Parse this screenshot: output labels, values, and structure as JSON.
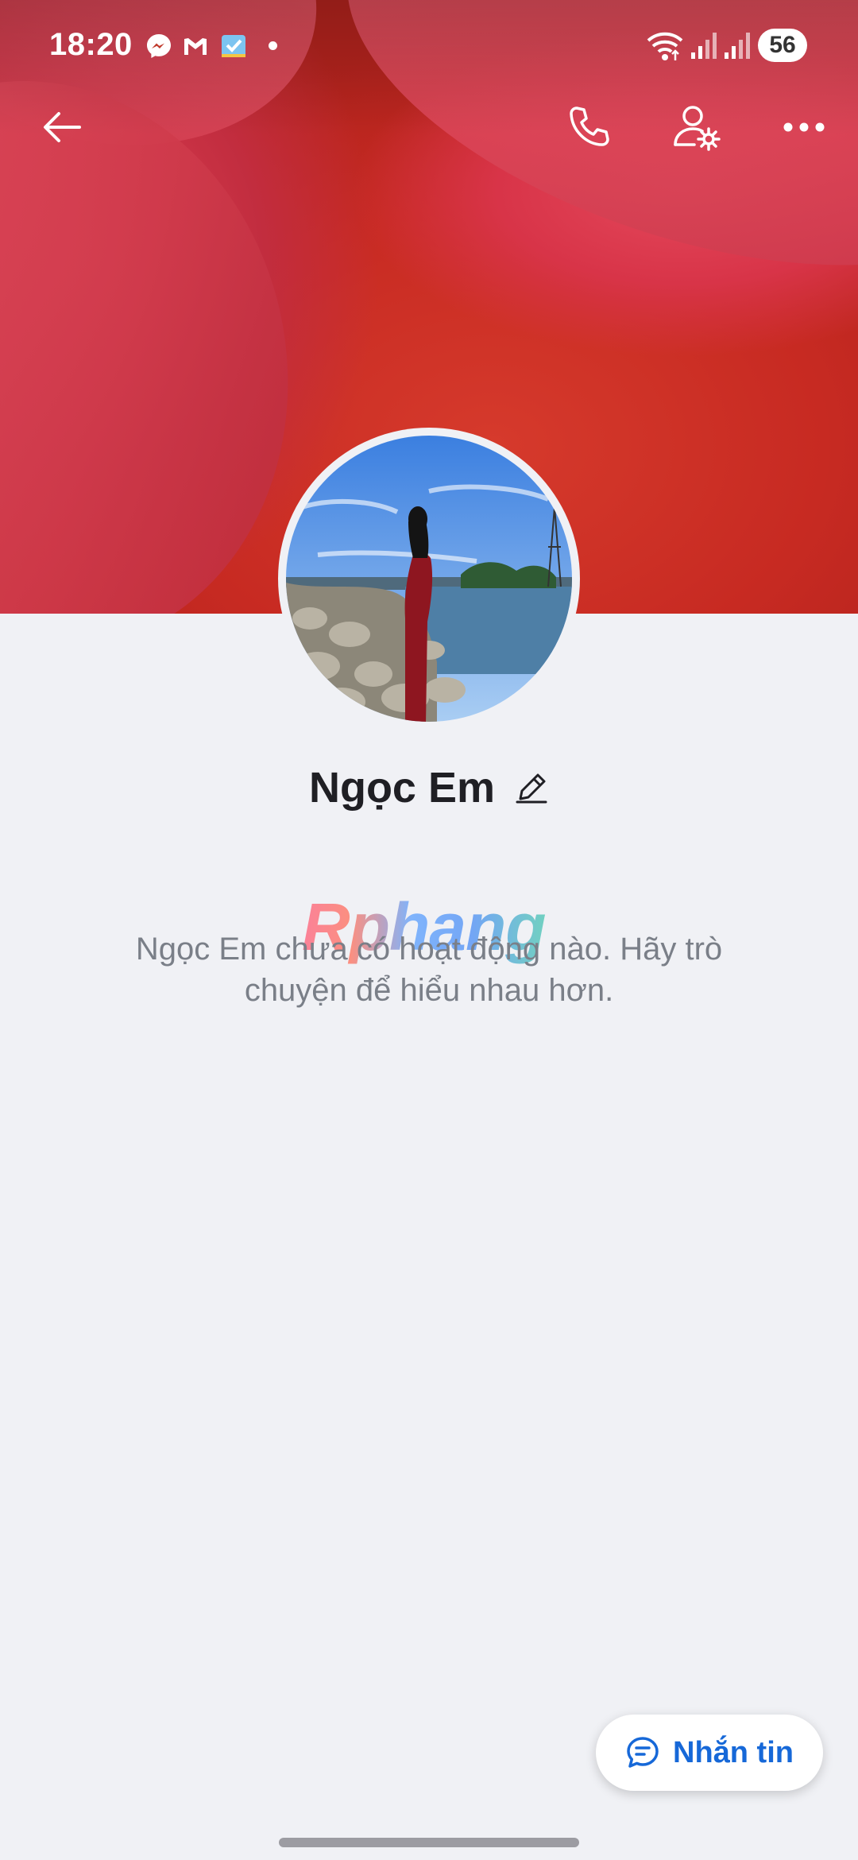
{
  "status_bar": {
    "time": "18:20",
    "battery": "56",
    "notification_icons": [
      "messenger-icon",
      "gmail-icon",
      "app-icon"
    ],
    "system_icons": [
      "wifi-icon",
      "signal-icon",
      "signal-icon"
    ]
  },
  "top_bar": {
    "icons": [
      "back-arrow-icon",
      "phone-icon",
      "profile-settings-icon",
      "more-icon"
    ]
  },
  "profile": {
    "name": "Ngọc Em",
    "edit_icon": "pencil-icon",
    "empty_message": "Ngọc Em chưa có hoạt động nào. Hãy trò chuyện để hiểu nhau hơn."
  },
  "watermark": "Rphang",
  "fab": {
    "label": "Nhắn tin",
    "icon": "chat-icon",
    "color": "#1668d8"
  },
  "colors": {
    "background": "#f0f1f5",
    "accent": "#1668d8"
  }
}
